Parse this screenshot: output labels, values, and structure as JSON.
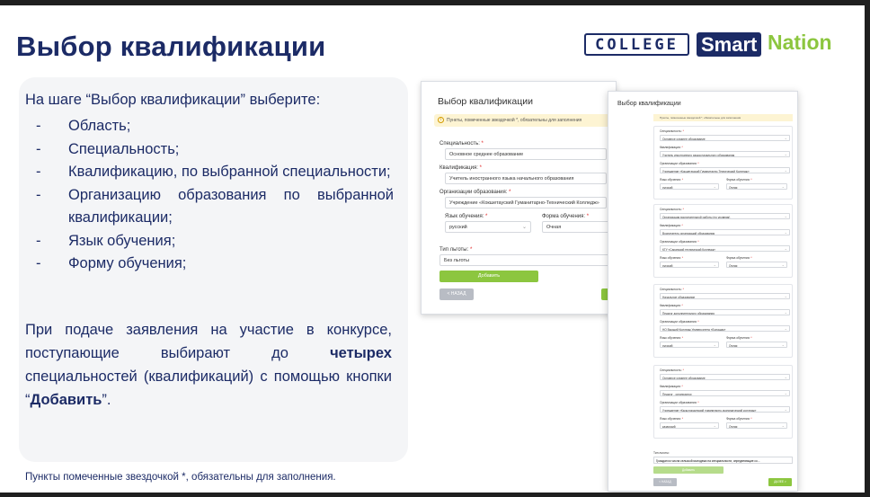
{
  "slide": {
    "title": "Выбор квалификации",
    "logo": {
      "college": "COLLEGE",
      "smart": "Smart",
      "nation": "Nation"
    },
    "intro": "На шаге “Выбор квалификации” выберите:",
    "bullet": "-",
    "steps": [
      "Область;",
      "Специальность;",
      "Квалификацию, по выбранной специальности;",
      "Организацию образования по выбранной квалификации;",
      "Язык обучения;",
      "Форму обучения;"
    ],
    "note": {
      "part1": "При подаче заявления на участие в конкурсе, поступающие выбирают до ",
      "bold1": "четырех",
      "part2": " специальностей (квалификаций) с помощью кнопки “",
      "bold2": "Добавить",
      "part3": "”."
    },
    "footnote": "Пункты помеченные звездочкой *, обязательны для заполнения."
  },
  "form_small": {
    "title": "Выбор квалификации",
    "warning": "Пункты, помеченные звездочкой *, обязательны для заполнения",
    "required_mark": "*",
    "specialty_label": "Специальность:",
    "specialty_value": "Основное среднее образование",
    "qualification_label": "Квалификация:",
    "qualification_value": "Учитель иностранного языка начального образования",
    "organization_label": "Организации образования:",
    "organization_value": "Учреждение «Кокшетауский Гуманитарно-Технический Колледж»",
    "language_label": "Язык обучения:",
    "language_value": "русский",
    "form_label": "Форма обучения:",
    "form_value": "Очная",
    "benefit_label": "Тип льготы:",
    "benefit_value": "Без льготы",
    "add_button": "Добавить",
    "back_button": "< НАЗАД"
  },
  "form_large": {
    "title": "Выбор квалификации",
    "warning": "Пункты, помеченные звездочкой *, обязательны для заполнения",
    "labels": {
      "specialty": "Специальность:",
      "qualification": "Квалификация:",
      "organization": "Организации образования:",
      "language": "Язык обучения:",
      "form": "Форма обучения:"
    },
    "blocks": [
      {
        "specialty": "Основное среднее образование",
        "qualification": "Учитель иностранного языка начального образования",
        "organization": "Учреждение «Кокшетауский Гуманитарно-Технический Колледж»",
        "language": "русский",
        "form": "Очная"
      },
      {
        "specialty": "Организация воспитательной работы (по уровням)",
        "qualification": "Воспитатель организаций образования",
        "organization": "КГУ «Саранский технический Колледж»",
        "language": "русский",
        "form": "Очная"
      },
      {
        "specialty": "Начальное образование",
        "qualification": "Педагог дополнительного образования",
        "organization": "НО Высший Колледж Университета «Болашак»",
        "language": "русский",
        "form": "Очная"
      },
      {
        "specialty": "Основное среднее образование",
        "qualification": "Педагог - организатор",
        "organization": "Учреждение «Кызылординский гуманитарно-экономический колледж»",
        "language": "казахский",
        "form": "Очная"
      }
    ],
    "benefit_label": "Тип льготы:",
    "benefit_value": "Граждан из числа сельской молодежи на специальности, определяющие со...",
    "add_button": "Добавить",
    "back_button": "< НАЗАД",
    "next_button": "ДАЛЕЕ >"
  }
}
